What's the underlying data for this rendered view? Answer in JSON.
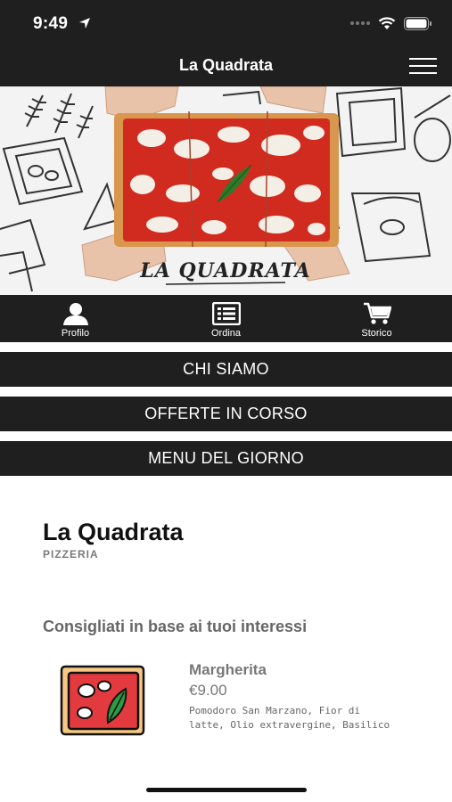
{
  "status": {
    "time": "9:49"
  },
  "nav": {
    "title": "La Quadrata"
  },
  "hero": {
    "logo_text": "LA QUADRATA"
  },
  "tabs": [
    {
      "label": "Profilo",
      "icon": "person-icon"
    },
    {
      "label": "Ordina",
      "icon": "list-icon"
    },
    {
      "label": "Storico",
      "icon": "cart-icon"
    }
  ],
  "menu": [
    {
      "label": "CHI SIAMO"
    },
    {
      "label": "OFFERTE IN CORSO"
    },
    {
      "label": "MENU DEL GIORNO"
    }
  ],
  "shop": {
    "name": "La Quadrata",
    "type": "PIZZERIA"
  },
  "recommended": {
    "title": "Consigliati in base ai tuoi interessi",
    "items": [
      {
        "name": "Margherita",
        "price": "€9.00",
        "description": "Pomodoro San Marzano, Fior di latte, Olio extravergine, Basilico",
        "icon": "pizza-icon"
      }
    ]
  },
  "colors": {
    "bar": "#1f1f1f",
    "text_muted": "#777777"
  }
}
